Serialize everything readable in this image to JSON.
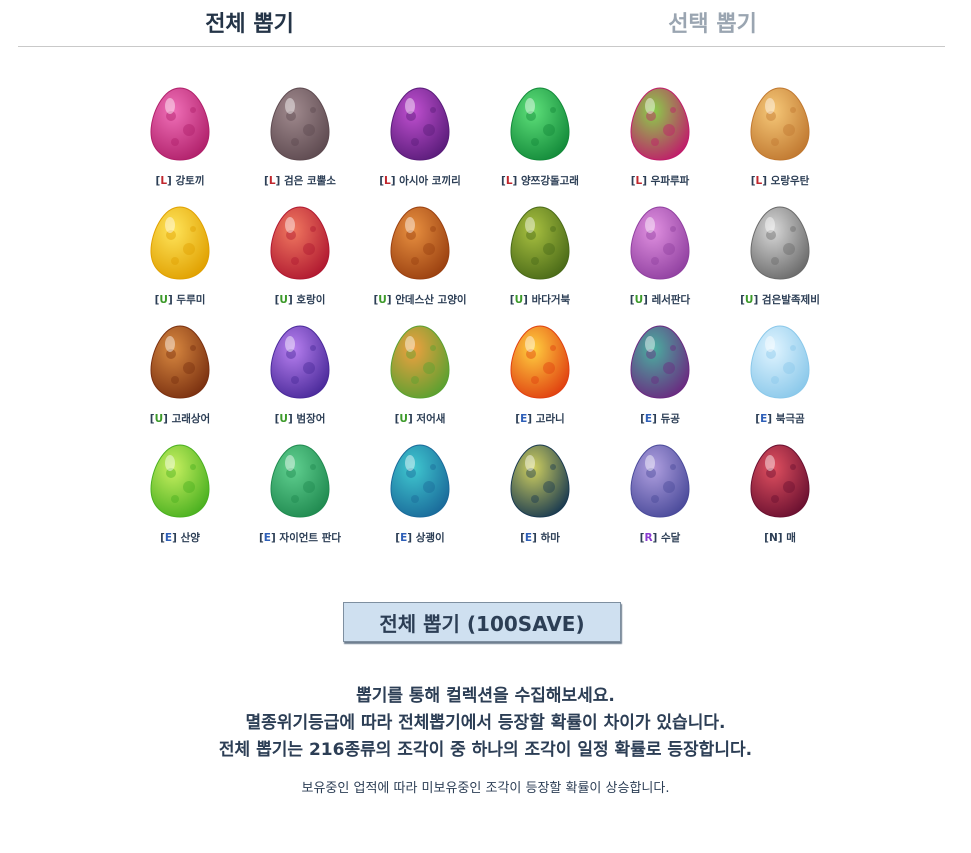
{
  "tabs": {
    "all_draw": "전체 뽑기",
    "select_draw": "선택 뽑기"
  },
  "eggs": [
    {
      "grade": "L",
      "name": "강토끼",
      "colors": [
        "#f070b8",
        "#b0206a"
      ]
    },
    {
      "grade": "L",
      "name": "검은 코뿔소",
      "colors": [
        "#a08a8e",
        "#5e4a50"
      ]
    },
    {
      "grade": "L",
      "name": "아시아 코끼리",
      "colors": [
        "#c050d0",
        "#5a1c7a"
      ]
    },
    {
      "grade": "L",
      "name": "양쯔강돌고래",
      "colors": [
        "#5ee07a",
        "#138a3a"
      ]
    },
    {
      "grade": "L",
      "name": "우파루파",
      "colors": [
        "#8ad04a",
        "#c01c6a"
      ]
    },
    {
      "grade": "L",
      "name": "오랑우탄",
      "colors": [
        "#f6c878",
        "#c07830"
      ]
    },
    {
      "grade": "U",
      "name": "두루미",
      "colors": [
        "#ffe45a",
        "#e0a000"
      ]
    },
    {
      "grade": "U",
      "name": "호랑이",
      "colors": [
        "#f07860",
        "#b01830"
      ]
    },
    {
      "grade": "U",
      "name": "안데스산 고양이",
      "colors": [
        "#e89040",
        "#9a4010"
      ]
    },
    {
      "grade": "U",
      "name": "바다거북",
      "colors": [
        "#a8c040",
        "#4a6a18"
      ]
    },
    {
      "grade": "U",
      "name": "레서판다",
      "colors": [
        "#e090e0",
        "#9040a0"
      ]
    },
    {
      "grade": "U",
      "name": "검은발족제비",
      "colors": [
        "#d8d8d8",
        "#6a6a6a"
      ]
    },
    {
      "grade": "U",
      "name": "고래상어",
      "colors": [
        "#d88840",
        "#7a3010"
      ]
    },
    {
      "grade": "U",
      "name": "범장어",
      "colors": [
        "#b880f0",
        "#4a2a9a"
      ]
    },
    {
      "grade": "U",
      "name": "저어새",
      "colors": [
        "#f0a040",
        "#5aa030"
      ]
    },
    {
      "grade": "E",
      "name": "고라니",
      "colors": [
        "#ffd040",
        "#e04010"
      ]
    },
    {
      "grade": "E",
      "name": "듀공",
      "colors": [
        "#4ab0a0",
        "#6a2a80"
      ]
    },
    {
      "grade": "E",
      "name": "북극곰",
      "colors": [
        "#e0f4ff",
        "#8ac8ea"
      ]
    },
    {
      "grade": "E",
      "name": "산양",
      "colors": [
        "#c8f060",
        "#4ab020"
      ]
    },
    {
      "grade": "E",
      "name": "자이언트 판다",
      "colors": [
        "#60d090",
        "#208a50"
      ]
    },
    {
      "grade": "E",
      "name": "상괭이",
      "colors": [
        "#40c8d0",
        "#1a6a9a"
      ]
    },
    {
      "grade": "E",
      "name": "하마",
      "colors": [
        "#d0d060",
        "#1a3a50"
      ]
    },
    {
      "grade": "R",
      "name": "수달",
      "colors": [
        "#b0a0e0",
        "#4a4a9a"
      ]
    },
    {
      "grade": "N",
      "name": "매",
      "colors": [
        "#e05060",
        "#6a1030"
      ]
    }
  ],
  "draw_button": "전체 뽑기 (100SAVE)",
  "description": {
    "line1": "뽑기를 통해 컬렉션을 수집해보세요.",
    "line2": "멸종위기등급에 따라 전체뽑기에서 등장할 확률이 차이가 있습니다.",
    "line3": "전체 뽑기는 216종류의 조각이 중 하나의 조각이 일정 확률로 등장합니다.",
    "note": "보유중인 업적에 따라 미보유중인 조각이 등장할 확률이 상승합니다."
  }
}
